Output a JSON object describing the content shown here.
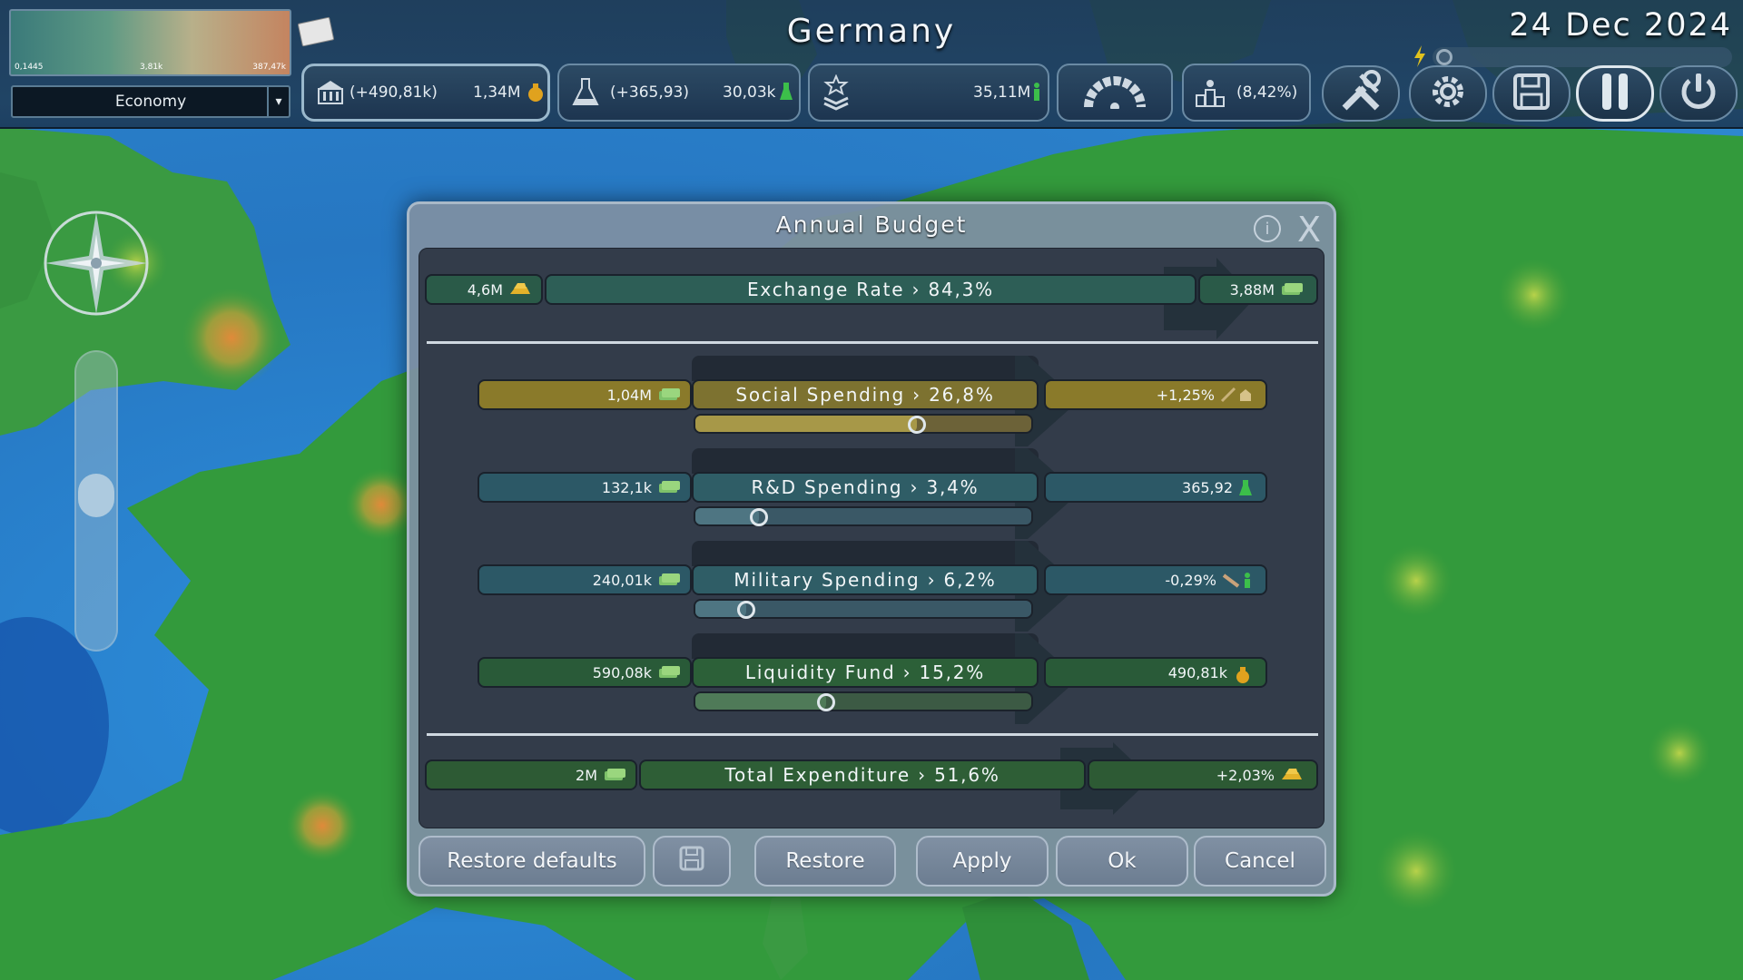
{
  "topbar": {
    "legend": {
      "min": "0,1445",
      "mid": "3,81k",
      "max": "387,47k"
    },
    "map_mode": "Economy",
    "country": "Germany",
    "date": "24 Dec 2024",
    "money": {
      "delta": "(+490,81k)",
      "total": "1,34M"
    },
    "research": {
      "delta": "(+365,93)",
      "total": "30,03k"
    },
    "population": {
      "total": "35,11M"
    },
    "approval": {
      "value": "(8,42%)"
    }
  },
  "dialog": {
    "title": "Annual Budget",
    "exchange": {
      "left": "4,6M",
      "label": "Exchange Rate › 84,3%",
      "right": "3,88M"
    },
    "rows": [
      {
        "left": "1,04M",
        "label": "Social Spending › 26,8%",
        "right": "+1,25%",
        "slider": 0.66
      },
      {
        "left": "132,1k",
        "label": "R&D Spending › 3,4%",
        "right": "365,92",
        "slider": 0.19
      },
      {
        "left": "240,01k",
        "label": "Military Spending › 6,2%",
        "right": "-0,29%",
        "slider": 0.15
      },
      {
        "left": "590,08k",
        "label": "Liquidity Fund › 15,2%",
        "right": "490,81k",
        "slider": 0.39
      }
    ],
    "total": {
      "left": "2M",
      "label": "Total Expenditure › 51,6%",
      "right": "+2,03%"
    },
    "buttons": {
      "restore_defaults": "Restore defaults",
      "restore": "Restore",
      "apply": "Apply",
      "ok": "Ok",
      "cancel": "Cancel"
    }
  },
  "colors": {
    "gold": "#8a7a2a",
    "teal": "#2a5a66",
    "green": "#295a38",
    "map_land": "#2f8f3a",
    "map_sea": "#2a86cf"
  }
}
